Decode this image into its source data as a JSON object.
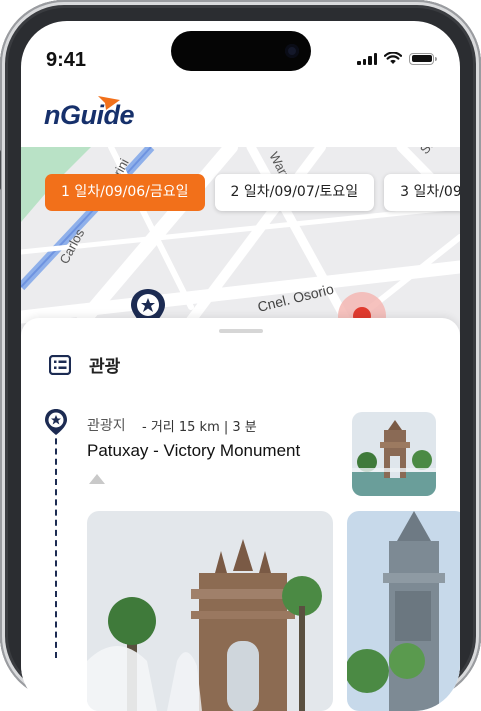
{
  "status": {
    "time": "9:41"
  },
  "app": {
    "logo": "nGuide"
  },
  "map": {
    "streets": [
      "Carlos",
      "rini",
      "Warr",
      "Sayo",
      "Cnel. Osorio"
    ]
  },
  "day_tabs": [
    {
      "label": "1 일차/09/06/금요일",
      "active": true
    },
    {
      "label": "2 일차/09/07/토요일",
      "active": false
    },
    {
      "label": "3 일차/09/",
      "active": false
    }
  ],
  "section": {
    "title": "관광"
  },
  "spot": {
    "category": "관광지",
    "distance": "- 거리 15 km | 3 분",
    "name": "Patuxay - Victory Monument"
  },
  "colors": {
    "accent": "#f2701a",
    "navy": "#16306b",
    "marker_red": "#e03a2e"
  },
  "icons": [
    "signal-icon",
    "wifi-icon",
    "battery-icon",
    "location-pin-icon",
    "current-location-icon",
    "list-icon",
    "timeline-pin-icon",
    "collapse-triangle-icon"
  ]
}
